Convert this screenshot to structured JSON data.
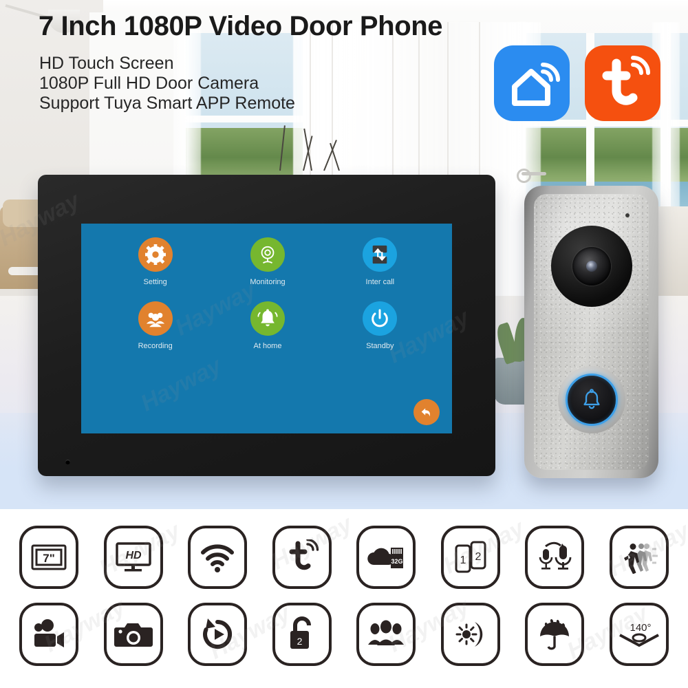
{
  "header": {
    "title": "7 Inch 1080P Video Door Phone",
    "subtitles": [
      "HD Touch Screen",
      "1080P Full HD Door Camera",
      "Support Tuya Smart APP Remote"
    ]
  },
  "app_logos": [
    {
      "name": "smart-life-logo",
      "icon": "house-wifi-icon",
      "color": "#2b8cf0"
    },
    {
      "name": "tuya-logo",
      "icon": "tuya-t-wifi-icon",
      "color": "#f5500f"
    }
  ],
  "monitor": {
    "screen_color": "#1478ad",
    "bezel_color": "#1d1d1d",
    "menu": [
      {
        "label": "Setting",
        "icon": "gear-icon",
        "color": "#e1822e"
      },
      {
        "label": "Monitoring",
        "icon": "webcam-icon",
        "color": "#76b72f"
      },
      {
        "label": "Inter call",
        "icon": "intercom-icon",
        "color": "#1ba3e0"
      },
      {
        "label": "Recording",
        "icon": "people-icon",
        "color": "#e1822e"
      },
      {
        "label": "At home",
        "icon": "bell-icon",
        "color": "#76b72f"
      },
      {
        "label": "Standby",
        "icon": "power-icon",
        "color": "#1ba3e0"
      }
    ],
    "back_button": {
      "icon": "back-arrow-icon",
      "color": "#e1822e"
    }
  },
  "doorbell": {
    "body_color": "#c4c4c1",
    "button_glow_color": "#3d9fe8",
    "parts": [
      "camera-lens",
      "microphone-hole",
      "bell-button"
    ]
  },
  "features": {
    "row1": [
      {
        "icon": "screen-size-icon",
        "label": "7\""
      },
      {
        "icon": "hd-monitor-icon",
        "label": "HD"
      },
      {
        "icon": "wifi-icon",
        "label": ""
      },
      {
        "icon": "tuya-icon",
        "label": ""
      },
      {
        "icon": "cloud-sdcard-icon",
        "label": "32G"
      },
      {
        "icon": "two-phones-icon",
        "label": "1 2"
      },
      {
        "icon": "two-way-audio-icon",
        "label": ""
      },
      {
        "icon": "motion-detection-icon",
        "label": ""
      }
    ],
    "row2": [
      {
        "icon": "video-record-icon",
        "label": ""
      },
      {
        "icon": "snapshot-camera-icon",
        "label": ""
      },
      {
        "icon": "playback-icon",
        "label": ""
      },
      {
        "icon": "unlock-icon",
        "label": "2"
      },
      {
        "icon": "multi-user-icon",
        "label": ""
      },
      {
        "icon": "day-night-icon",
        "label": ""
      },
      {
        "icon": "waterproof-icon",
        "label": ""
      },
      {
        "icon": "wide-angle-icon",
        "label": "140°"
      }
    ]
  },
  "watermark": {
    "text": "Hayway"
  }
}
